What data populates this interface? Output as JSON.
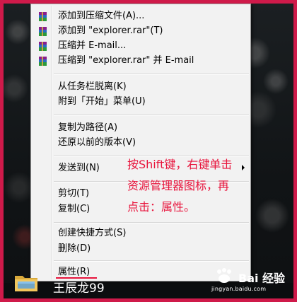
{
  "context_menu": {
    "groups": [
      [
        {
          "label": "添加到压缩文件(A)...",
          "icon": "winrar-books-icon"
        },
        {
          "label": "添加到 \"explorer.rar\"(T)",
          "icon": "winrar-books-icon"
        },
        {
          "label": "压缩并 E-mail...",
          "icon": "winrar-books-icon"
        },
        {
          "label": "压缩到 \"explorer.rar\" 并 E-mail",
          "icon": "winrar-books-icon"
        }
      ],
      [
        {
          "label": "从任务栏脱离(K)"
        },
        {
          "label": "附到「开始」菜单(U)"
        }
      ],
      [
        {
          "label": "复制为路径(A)"
        },
        {
          "label": "还原以前的版本(V)"
        }
      ],
      [
        {
          "label": "发送到(N)",
          "has_submenu": true
        }
      ],
      [
        {
          "label": "剪切(T)"
        },
        {
          "label": "复制(C)"
        }
      ],
      [
        {
          "label": "创建快捷方式(S)"
        },
        {
          "label": "删除(D)"
        }
      ],
      [
        {
          "label": "属性(R)"
        }
      ]
    ]
  },
  "annotation": {
    "lines": [
      "按Shift键，右键单击",
      "资源管理器图标，再",
      "点击：属性。"
    ],
    "color": "#e8143c"
  },
  "taskbar": {
    "user_name": "王辰龙99",
    "folder_icon": "explorer-folder-icon"
  },
  "watermark": {
    "brand": "Bai 经验",
    "url": "jingyan.baidu.com"
  },
  "colors": {
    "frame": "#cf1a4a",
    "menu_bg": "#f2f2f2",
    "accent_red": "#e8143c"
  }
}
